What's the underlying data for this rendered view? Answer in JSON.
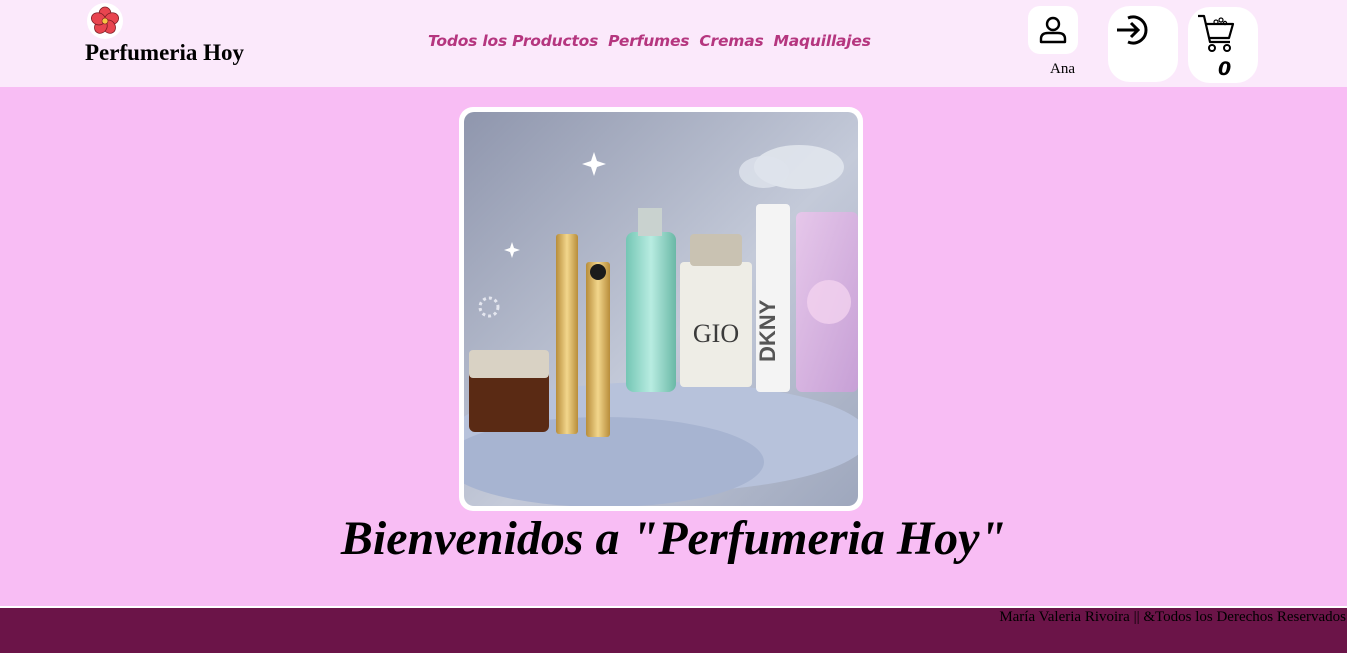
{
  "brand": {
    "name": "Perfumeria Hoy",
    "logo_icon": "hibiscus-flower-icon"
  },
  "nav": {
    "items": [
      "Todos los Productos",
      "Perfumes",
      "Cremas",
      "Maquillajes"
    ]
  },
  "user": {
    "icon": "user-icon",
    "name": "Ana"
  },
  "login": {
    "icon": "login-arrow-icon"
  },
  "cart": {
    "icon": "shopping-cart-icon",
    "count": "0"
  },
  "hero": {
    "image_alt": "Cosmetics and perfume products display",
    "heading": "Bienvenidos a \"Perfumeria Hoy\""
  },
  "footer": {
    "text": "María Valeria Rivoira || &Todos los Derechos Reservados"
  },
  "colors": {
    "page_background": "#f8bdf4",
    "header_background": "#fbe9fb",
    "nav_link": "#b5367f",
    "footer_background": "#6b1448"
  }
}
